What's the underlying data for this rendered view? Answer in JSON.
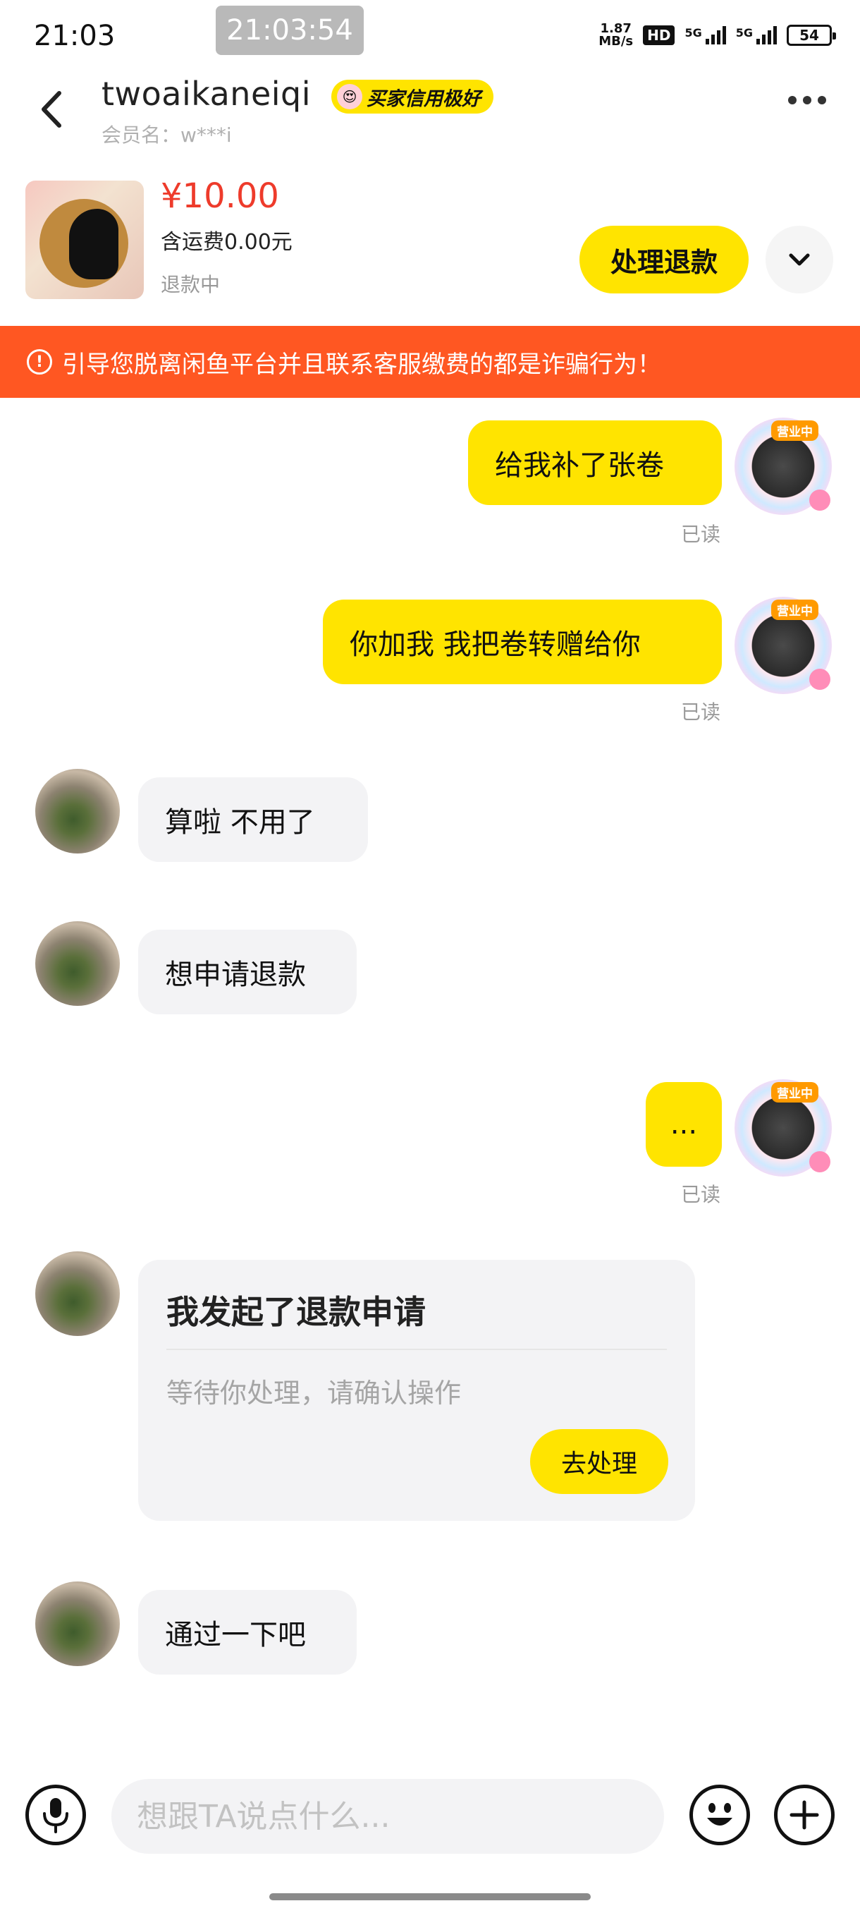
{
  "status_bar": {
    "time": "21:03",
    "recording_time": "21:03:54",
    "net_speed_value": "1.87",
    "net_speed_unit": "MB/s",
    "hd_label": "HD",
    "signal1_label": "5G",
    "signal2_label": "5G",
    "battery": "54"
  },
  "header": {
    "username": "twoaikaneiqi",
    "credit_badge": "买家信用极好",
    "member_name": "会员名：w***i"
  },
  "product": {
    "price": "¥10.00",
    "shipping": "含运费0.00元",
    "status": "退款中",
    "refund_button": "处理退款"
  },
  "warning": {
    "text": "引导您脱离闲鱼平台并且联系客服缴费的都是诈骗行为！"
  },
  "messages": [
    {
      "from": "me",
      "text": "给我补了张卷",
      "status": "已读"
    },
    {
      "from": "me",
      "text": "你加我 我把卷转赠给你",
      "status": "已读"
    },
    {
      "from": "them",
      "text": "算啦 不用了"
    },
    {
      "from": "them",
      "text": "想申请退款"
    },
    {
      "from": "me",
      "text": "...",
      "status": "已读"
    },
    {
      "from": "them",
      "card": {
        "title": "我发起了退款申请",
        "subtitle": "等待你处理，请确认操作",
        "button": "去处理"
      }
    },
    {
      "from": "them",
      "text": "通过一下吧"
    }
  ],
  "avatar_badge": "营业中",
  "input": {
    "placeholder": "想跟TA说点什么..."
  },
  "colors": {
    "accent_yellow": "#ffe400",
    "warning_orange": "#ff5722",
    "price_red": "#ee3b2b"
  }
}
